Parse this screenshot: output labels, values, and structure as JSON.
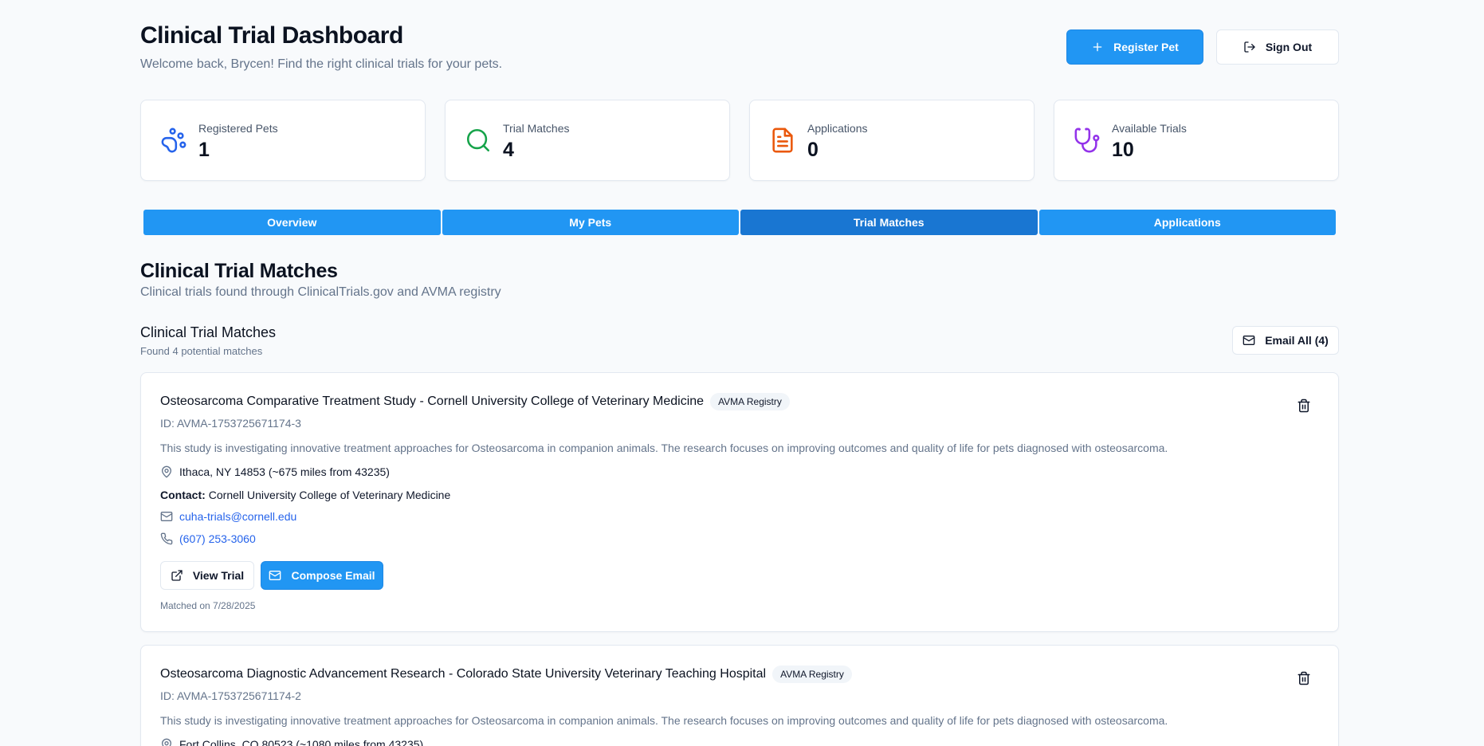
{
  "header": {
    "title": "Clinical Trial Dashboard",
    "welcome": "Welcome back, Brycen! Find the right clinical trials for your pets.",
    "register_label": "Register Pet",
    "signout_label": "Sign Out"
  },
  "stats": [
    {
      "label": "Registered Pets",
      "value": "1",
      "icon": "paw-icon",
      "color": "#2563eb"
    },
    {
      "label": "Trial Matches",
      "value": "4",
      "icon": "search-icon",
      "color": "#16a34a"
    },
    {
      "label": "Applications",
      "value": "0",
      "icon": "file-text-icon",
      "color": "#ea580c"
    },
    {
      "label": "Available Trials",
      "value": "10",
      "icon": "stethoscope-icon",
      "color": "#9333ea"
    }
  ],
  "tabs": [
    {
      "label": "Overview"
    },
    {
      "label": "My Pets"
    },
    {
      "label": "Trial Matches",
      "active": true
    },
    {
      "label": "Applications"
    }
  ],
  "section": {
    "title": "Clinical Trial Matches",
    "subtitle": "Clinical trials found through ClinicalTrials.gov and AVMA registry"
  },
  "matches": {
    "title": "Clinical Trial Matches",
    "subtitle": "Found 4 potential matches",
    "email_all_label": "Email All (4)"
  },
  "trials": [
    {
      "title": "Osteosarcoma Comparative Treatment Study - Cornell University College of Veterinary Medicine",
      "badge": "AVMA Registry",
      "id": "ID: AVMA-1753725671174-3",
      "description": "This study is investigating innovative treatment approaches for Osteosarcoma in companion animals. The research focuses on improving outcomes and quality of life for pets diagnosed with osteosarcoma.",
      "location": "Ithaca, NY 14853 (~675 miles from 43235)",
      "contact_label": "Contact:",
      "contact": "Cornell University College of Veterinary Medicine",
      "email": "cuha-trials@cornell.edu",
      "phone": "(607) 253-3060",
      "view_label": "View Trial",
      "compose_label": "Compose Email",
      "matched": "Matched on 7/28/2025"
    },
    {
      "title": "Osteosarcoma Diagnostic Advancement Research - Colorado State University Veterinary Teaching Hospital",
      "badge": "AVMA Registry",
      "id": "ID: AVMA-1753725671174-2",
      "description": "This study is investigating innovative treatment approaches for Osteosarcoma in companion animals. The research focuses on improving outcomes and quality of life for pets diagnosed with osteosarcoma.",
      "location": "Fort Collins, CO 80523 (~1080 miles from 43235)"
    }
  ]
}
